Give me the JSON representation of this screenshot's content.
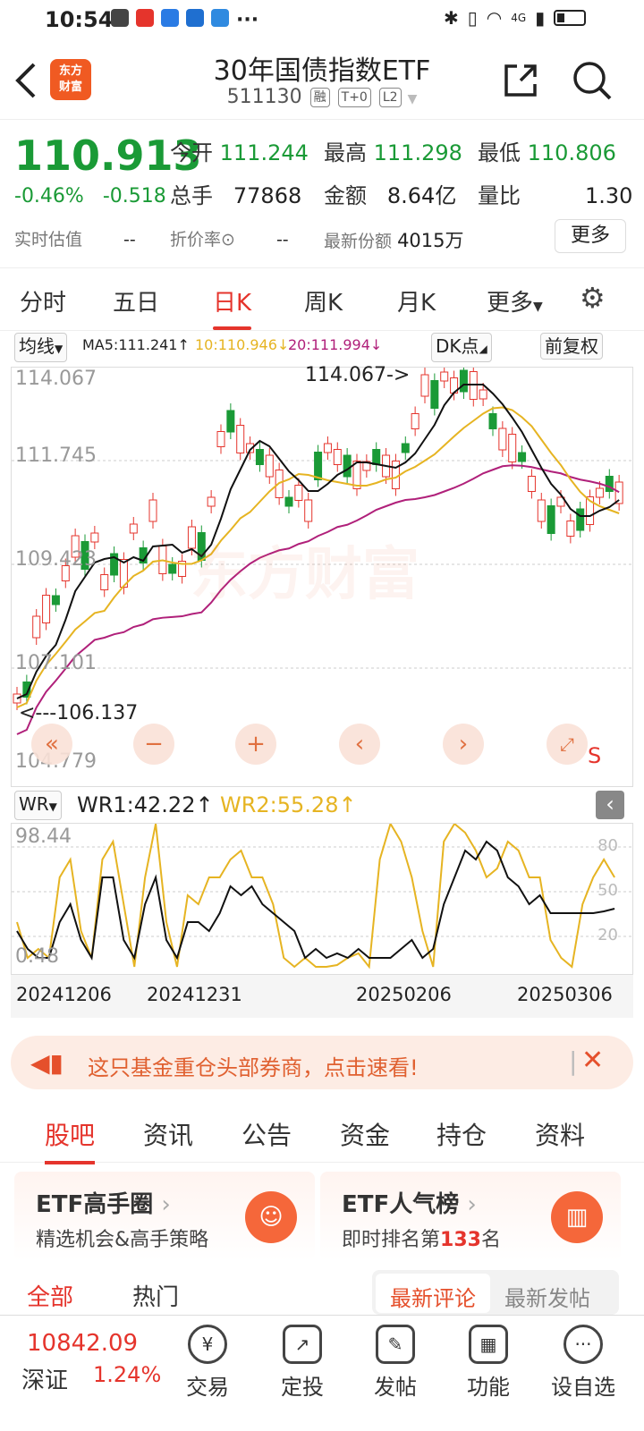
{
  "status": {
    "time": "10:54",
    "dots": "···",
    "net": "4G"
  },
  "header": {
    "logo": "东方\n财富",
    "title": "30年国债指数ETF",
    "code": "511130",
    "tags": [
      "融",
      "T+0",
      "L2"
    ]
  },
  "quote": {
    "price": "110.913",
    "pct": "-0.46%",
    "chg": "-0.518",
    "open_label": "今开",
    "open": "111.244",
    "high_label": "最高",
    "high": "111.298",
    "low_label": "最低",
    "low": "110.806",
    "vol_label": "总手",
    "vol": "77868",
    "amt_label": "金额",
    "amt": "8.64亿",
    "ratio_label": "量比",
    "ratio": "1.30",
    "est_label": "实时估值",
    "est": "--",
    "disc_label": "折价率",
    "disc": "--",
    "shares_label": "最新份额",
    "shares": "4015万",
    "more": "更多"
  },
  "tabs": [
    "分时",
    "五日",
    "日K",
    "周K",
    "月K",
    "更多"
  ],
  "ma": {
    "btn": "均线",
    "ma5": "MA5:111.241↑",
    "ma10": "10:110.946↓",
    "ma20": "20:111.994↓",
    "dk": "DK点",
    "adj": "前复权"
  },
  "kline": {
    "ylabels": [
      "114.067",
      "111.745",
      "109.423",
      "107.101",
      "104.779"
    ],
    "max_note": "114.067->",
    "min_note": "<---106.137",
    "watermark": "东方财富",
    "s_label": "S",
    "colors": {
      "up": "#e5342c",
      "down": "#1a9a36",
      "ma5": "#111111",
      "ma10": "#e6b422",
      "ma20": "#b0207a"
    }
  },
  "wr": {
    "btn": "WR",
    "wr1": "WR1:42.22↑",
    "wr2": "WR2:55.28↑",
    "ylabel_top": "98.44",
    "ylabel_bot": "0.48",
    "r80": "80",
    "r50": "50",
    "r20": "20"
  },
  "dates": [
    "20241206",
    "20241231",
    "20250206",
    "20250306"
  ],
  "banner": {
    "text": "这只基金重仓头部券商，点击速看!"
  },
  "ctabs": [
    "股吧",
    "资讯",
    "公告",
    "资金",
    "持仓",
    "资料"
  ],
  "cards": [
    {
      "title": "ETF高手圈",
      "sub": "精选机会&高手策略"
    },
    {
      "title": "ETF人气榜",
      "sub_pre": "即时排名第",
      "rank": "133",
      "sub_post": "名"
    }
  ],
  "subtabs": {
    "all": "全部",
    "hot": "热门",
    "latest_comment": "最新评论",
    "latest_post": "最新发帖"
  },
  "bottom": {
    "index_val": "10842.09",
    "index_name": "深证",
    "index_pct": "1.24%",
    "items": [
      "交易",
      "定投",
      "发帖",
      "功能",
      "设自选"
    ]
  }
}
